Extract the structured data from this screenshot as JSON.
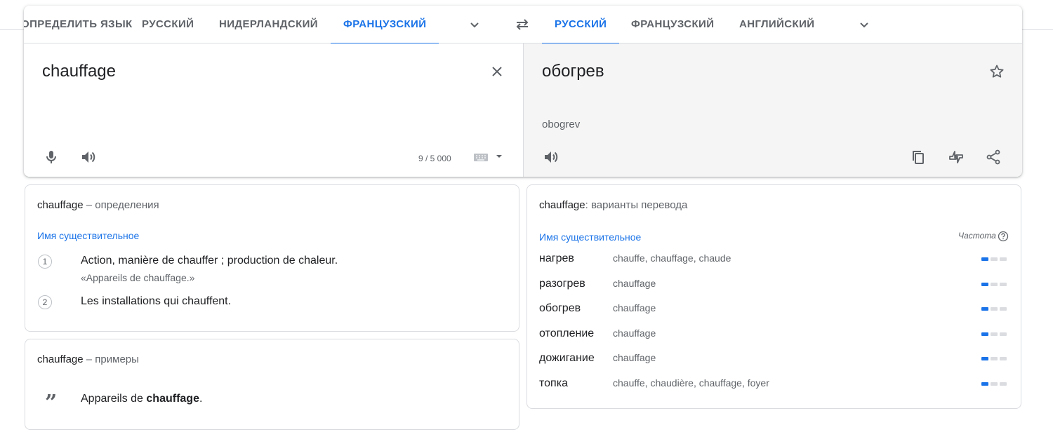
{
  "source_tabs": [
    "ОПРЕДЕЛИТЬ ЯЗЫК",
    "РУССКИЙ",
    "НИДЕРЛАНДСКИЙ",
    "ФРАНЦУЗСКИЙ"
  ],
  "target_tabs": [
    "РУССКИЙ",
    "ФРАНЦУЗСКИЙ",
    "АНГЛИЙСКИЙ"
  ],
  "source": {
    "text": "chauffage",
    "char_count": "9 / 5 000"
  },
  "target": {
    "text": "обогрев",
    "transliteration": "obogrev"
  },
  "icons": {
    "source_more": "chevron-down-icon",
    "swap": "swap-icon",
    "target_more": "chevron-down-icon",
    "clear": "close-icon",
    "mic": "mic-icon",
    "listen": "volume-icon",
    "keyboard": "keyboard-icon",
    "star": "star-icon",
    "copy": "copy-icon",
    "feedback": "feedback-icon",
    "share": "share-icon",
    "quote": "quote-icon",
    "help": "help-icon"
  },
  "definitions": {
    "word": "chauffage",
    "header_suffix": " – определения",
    "part_of_speech": "Имя существительное",
    "items": [
      {
        "num": "1",
        "text": "Action, manière de chauffer ; production de chaleur.",
        "example": "«Appareils de chauffage.»"
      },
      {
        "num": "2",
        "text": "Les installations qui chauffent.",
        "example": ""
      }
    ]
  },
  "examples": {
    "word": "chauffage",
    "header_suffix": " – примеры",
    "items": [
      {
        "before": "Appareils de ",
        "bold": "chauffage",
        "after": "."
      }
    ]
  },
  "translations": {
    "word": "chauffage",
    "header_suffix": ": варианты перевода",
    "part_of_speech": "Имя существительное",
    "frequency_label": "Частота",
    "rows": [
      {
        "word": "нагрев",
        "synonyms": "chauffe, chauffage, chaude",
        "frequency": 1
      },
      {
        "word": "разогрев",
        "synonyms": "chauffage",
        "frequency": 1
      },
      {
        "word": "обогрев",
        "synonyms": "chauffage",
        "frequency": 1
      },
      {
        "word": "отопление",
        "synonyms": "chauffage",
        "frequency": 1
      },
      {
        "word": "дожигание",
        "synonyms": "chauffage",
        "frequency": 1
      },
      {
        "word": "топка",
        "synonyms": "chauffe, chaudière, chauffage, foyer",
        "frequency": 1
      }
    ]
  },
  "colors": {
    "accent": "#1a73e8",
    "text": "#202124",
    "muted": "#5f6368",
    "target_bg": "#f5f5f5"
  }
}
